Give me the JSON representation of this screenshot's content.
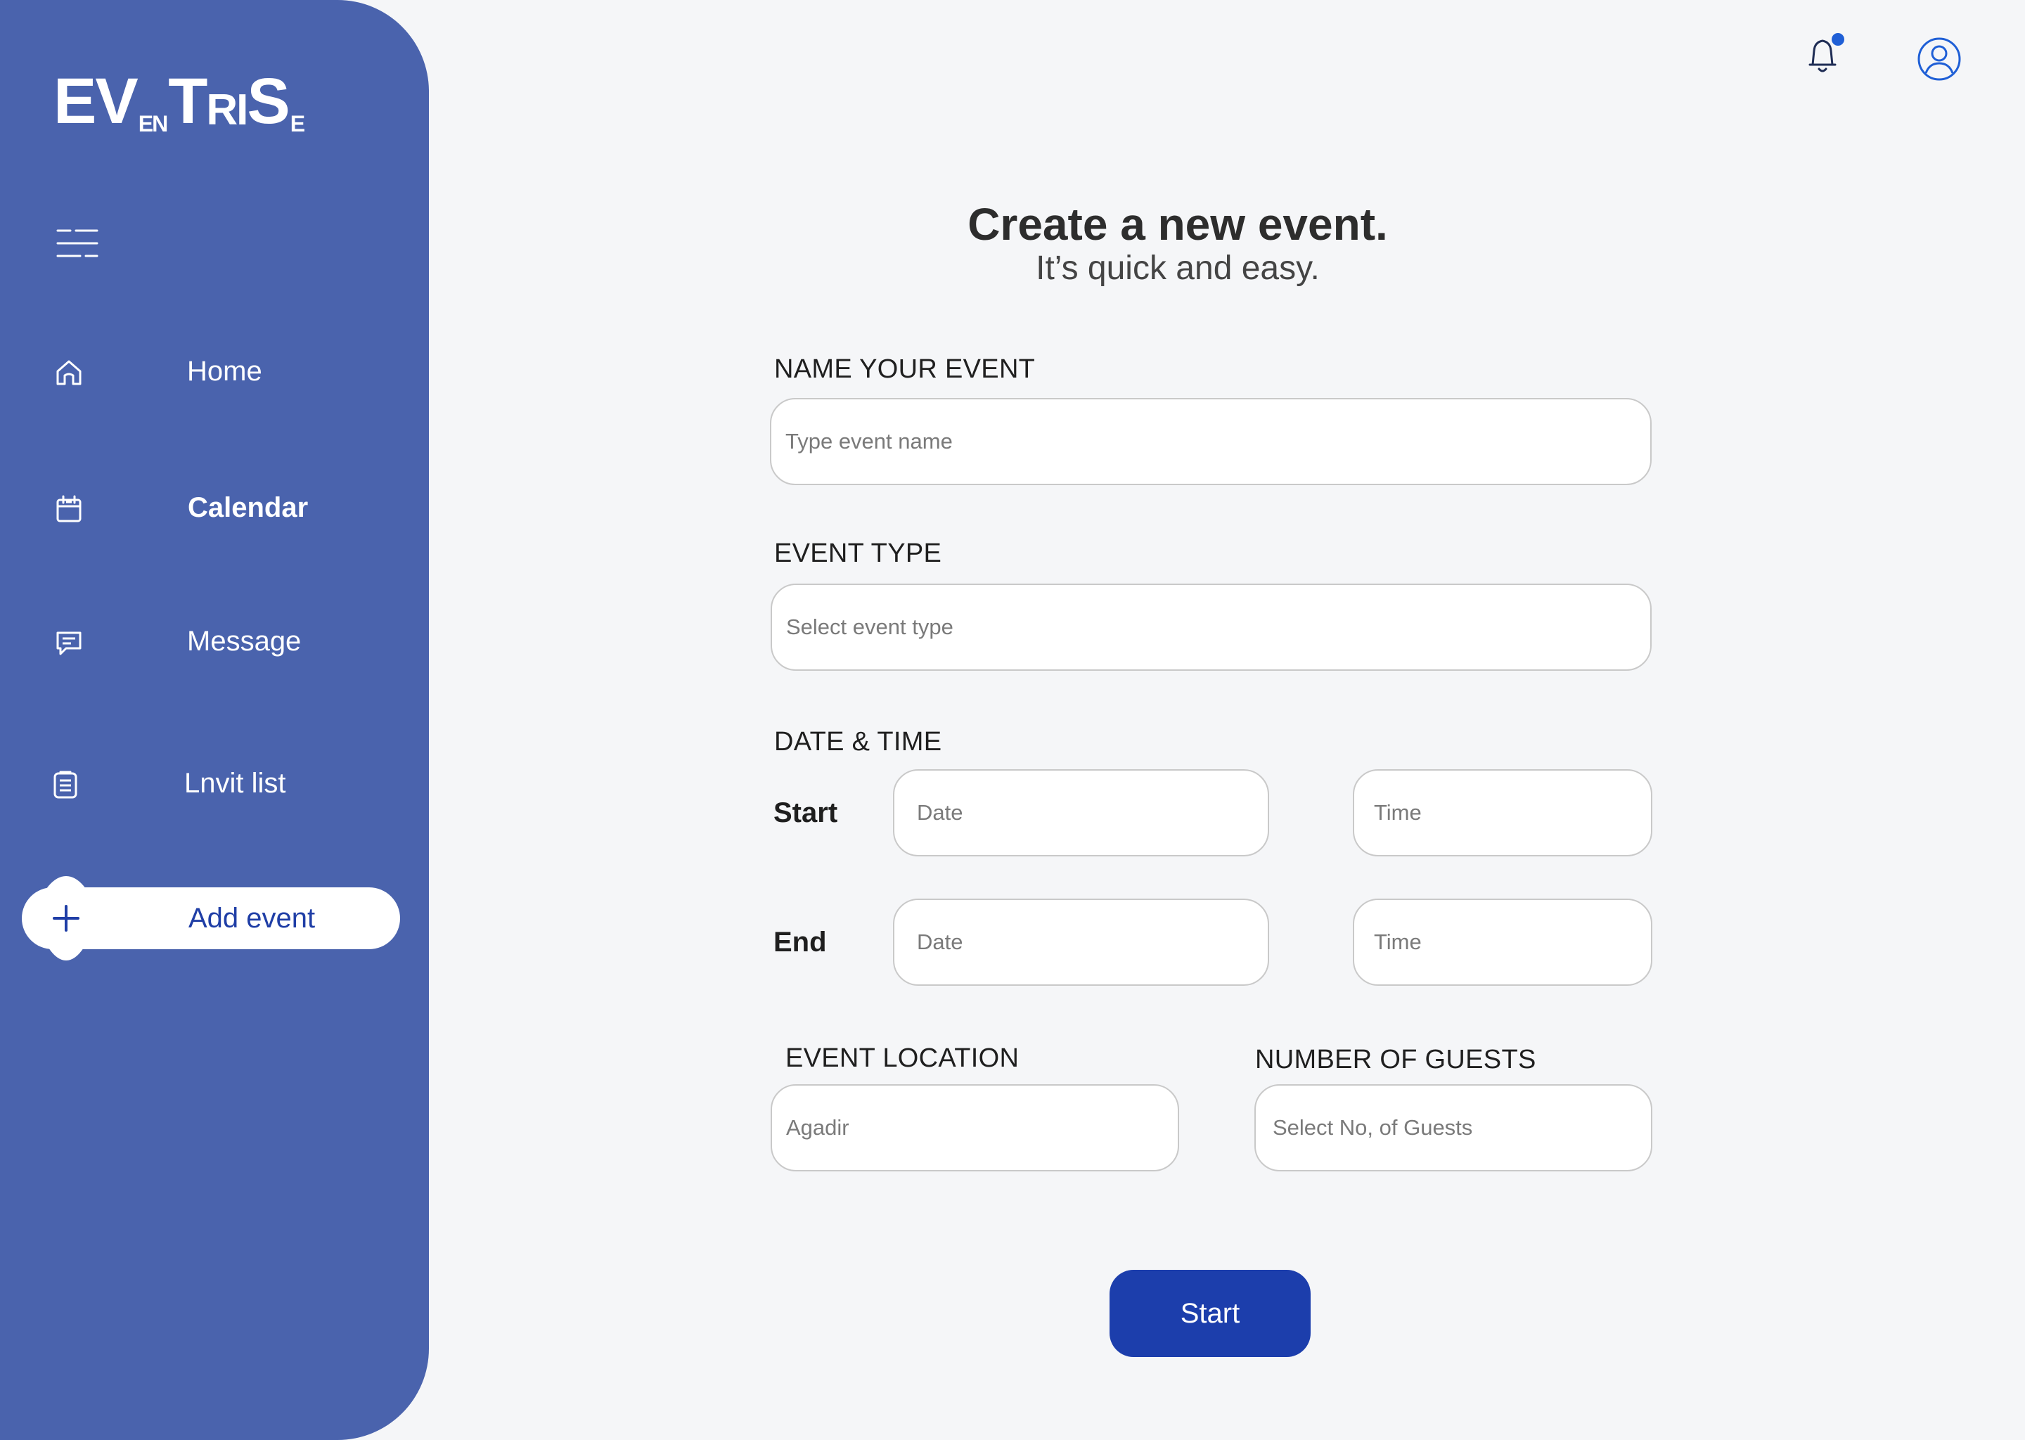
{
  "colors": {
    "sidebar_bg": "#4a63ad",
    "page_bg": "#f5f6f8",
    "accent": "#1c3eac",
    "notification_dot": "#1f5fd6"
  },
  "logo": {
    "part1": "EV",
    "part2": "EN",
    "part3": "T",
    "part4": "RI",
    "part5": "S",
    "part6": "E"
  },
  "sidebar": {
    "menu_icon": "hamburger-icon",
    "items": [
      {
        "label": "Home",
        "icon": "home-icon",
        "active": false
      },
      {
        "label": "Calendar",
        "icon": "calendar-icon",
        "active": true
      },
      {
        "label": "Message",
        "icon": "message-icon",
        "active": false
      },
      {
        "label": "Lnvit list",
        "icon": "clipboard-icon",
        "active": false
      }
    ],
    "add_event": {
      "label": "Add event",
      "icon": "plus-icon"
    }
  },
  "header": {
    "notification_icon": "bell-icon",
    "profile_icon": "user-icon"
  },
  "form": {
    "title": "Create a new event.",
    "subtitle": "It’s quick and easy.",
    "name_label": "NAME YOUR EVENT",
    "name_placeholder": "Type event name",
    "type_label": "EVENT TYPE",
    "type_placeholder": "Select event type",
    "datetime_label": "DATE & TIME",
    "start_label": "Start",
    "end_label": "End",
    "date_placeholder": "Date",
    "time_placeholder": "Time",
    "location_label": "EVENT LOCATION",
    "location_placeholder": "Agadir",
    "guests_label": "NUMBER OF GUESTS",
    "guests_placeholder": "Select No, of Guests",
    "submit_label": "Start"
  }
}
